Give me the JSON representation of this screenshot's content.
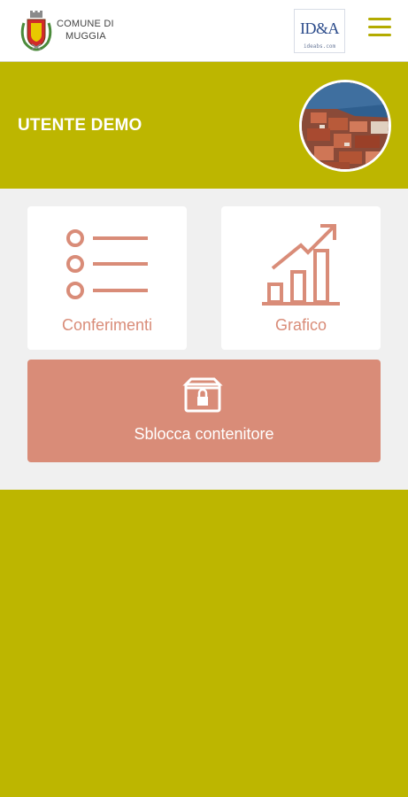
{
  "header": {
    "comune_line1": "COMUNE DI",
    "comune_line2": "MUGGIA",
    "logo_text": "ID&A",
    "logo_subtext": "ideabs.com",
    "menu_icon": "hamburger-menu-icon"
  },
  "user": {
    "name": "UTENTE DEMO"
  },
  "cards": {
    "conferimenti": {
      "label": "Conferimenti",
      "icon": "list-icon"
    },
    "grafico": {
      "label": "Grafico",
      "icon": "bar-chart-icon"
    }
  },
  "unlock": {
    "label": "Sblocca contenitore",
    "icon": "locked-bin-icon"
  },
  "colors": {
    "brand_olive": "#bdb600",
    "accent_salmon": "#d98c78",
    "panel_bg": "#f0f0f0"
  }
}
